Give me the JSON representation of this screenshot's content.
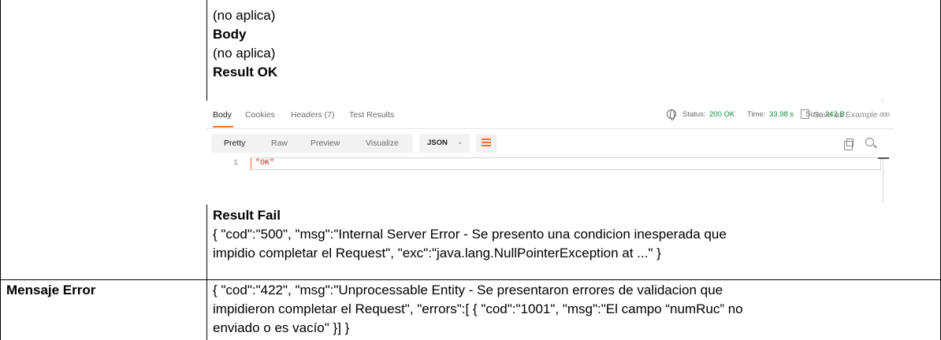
{
  "doc": {
    "no_aplica_1": "(no aplica)",
    "body_heading": "Body",
    "no_aplica_2": "(no aplica)",
    "result_ok_heading": "Result OK",
    "result_fail_heading": "Result Fail",
    "result_fail_line1": "{ \"cod\":\"500\", \"msg\":\"Internal Server Error - Se presento una condicion inesperada que",
    "result_fail_line2": "impidio completar el Request\", \"exc\":\"java.lang.NullPointerException at ...\" }",
    "mensaje_error_label": "Mensaje Error",
    "mensaje_error_line1": "{ \"cod\":\"422\", \"msg\":\"Unprocessable Entity - Se presentaron errores de validacion que",
    "mensaje_error_line2": "impidieron completar el Request\", \"errors\":[ { \"cod\":\"1001\", \"msg\":\"El campo “numRuc” no",
    "mensaje_error_line3": "enviado o es vacío\" }] }"
  },
  "postman": {
    "tabs": {
      "body": "Body",
      "cookies": "Cookies",
      "headers": "Headers",
      "headers_count": "(7)",
      "test_results": "Test Results"
    },
    "status_label": "Status:",
    "status_value": "200 OK",
    "time_label": "Time:",
    "time_value": "33.98 s",
    "size_label": "Size:",
    "size_value": "242 B",
    "save_example": "Save as Example",
    "more": "ooo",
    "views": {
      "pretty": "Pretty",
      "raw": "Raw",
      "preview": "Preview",
      "visualize": "Visualize"
    },
    "format": "JSON",
    "format_chevron": "⌄",
    "line_number": "1",
    "code_line": "\"OK\""
  }
}
